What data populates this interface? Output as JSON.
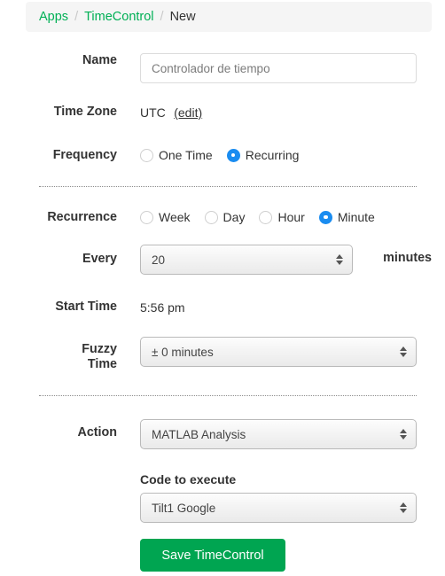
{
  "breadcrumb": {
    "items": [
      {
        "label": "Apps",
        "is_link": true
      },
      {
        "label": "TimeControl",
        "is_link": true
      },
      {
        "label": "New",
        "is_link": false
      }
    ],
    "separator": "/"
  },
  "form": {
    "name": {
      "label": "Name",
      "value": "Controlador de tiempo",
      "placeholder": "Controlador de tiempo"
    },
    "time_zone": {
      "label": "Time Zone",
      "value": "UTC",
      "edit_link": "(edit)"
    },
    "frequency": {
      "label": "Frequency",
      "options": [
        {
          "label": "One Time",
          "selected": false
        },
        {
          "label": "Recurring",
          "selected": true
        }
      ]
    },
    "recurrence": {
      "label": "Recurrence",
      "options": [
        {
          "label": "Week",
          "selected": false
        },
        {
          "label": "Day",
          "selected": false
        },
        {
          "label": "Hour",
          "selected": false
        },
        {
          "label": "Minute",
          "selected": true
        }
      ]
    },
    "every": {
      "label": "Every",
      "value": "20",
      "suffix": "minutes"
    },
    "start_time": {
      "label": "Start Time",
      "value": "5:56 pm"
    },
    "fuzzy_time": {
      "label": "Fuzzy Time",
      "label_line1": "Fuzzy",
      "label_line2": "Time",
      "value": "± 0 minutes"
    },
    "action": {
      "label": "Action",
      "value": "MATLAB Analysis"
    },
    "code_to_execute": {
      "label": "Code to execute",
      "value": "Tilt1 Google"
    },
    "save_button": {
      "label": "Save TimeControl"
    }
  },
  "colors": {
    "link_green": "#00b055",
    "button_green": "#00a551",
    "radio_blue": "#1a8cf0",
    "breadcrumb_bg": "#f5f5f5",
    "text_dark": "#333333"
  }
}
